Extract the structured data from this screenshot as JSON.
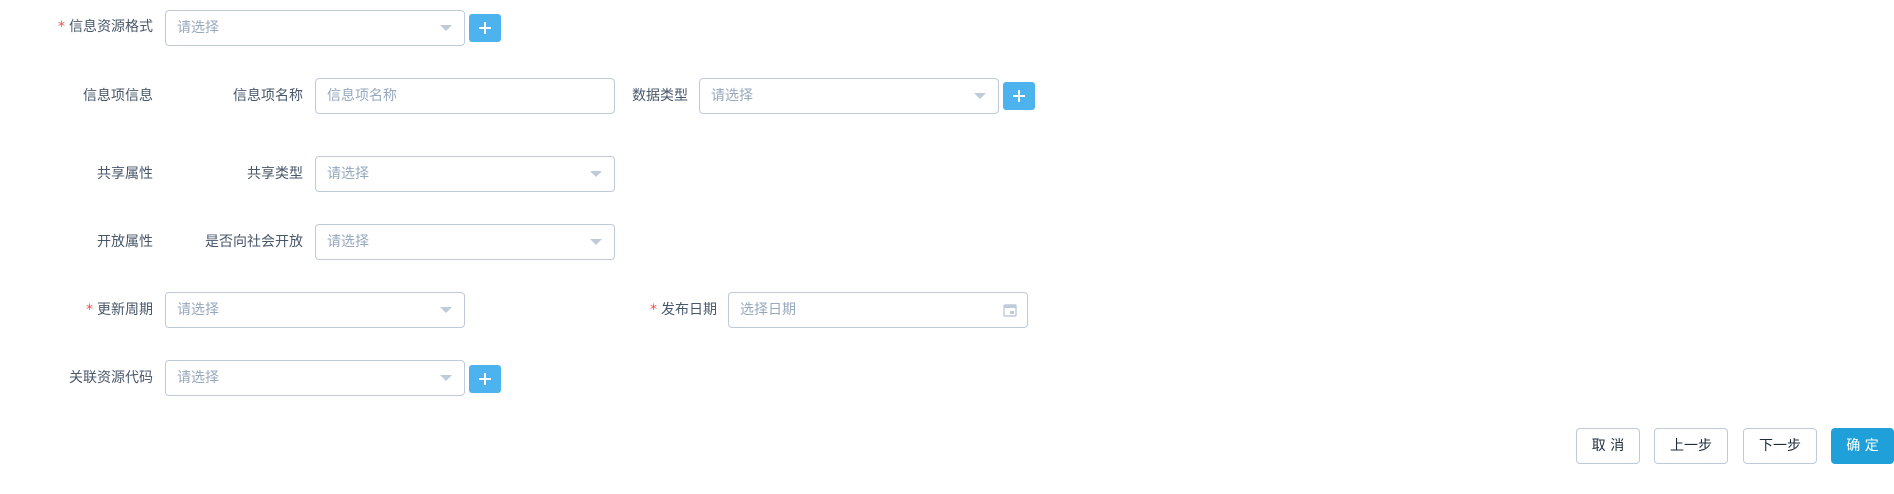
{
  "form": {
    "info_resource_format": {
      "label": "信息资源格式",
      "placeholder": "请选择"
    },
    "info_item": {
      "section_label": "信息项信息",
      "name_label": "信息项名称",
      "name_placeholder": "信息项名称",
      "data_type_label": "数据类型",
      "data_type_placeholder": "请选择"
    },
    "share": {
      "section_label": "共享属性",
      "type_label": "共享类型",
      "type_placeholder": "请选择"
    },
    "open": {
      "section_label": "开放属性",
      "public_label": "是否向社会开放",
      "public_placeholder": "请选择"
    },
    "update_cycle": {
      "label": "更新周期",
      "placeholder": "请选择"
    },
    "publish_date": {
      "label": "发布日期",
      "placeholder": "选择日期"
    },
    "related_resource": {
      "label": "关联资源代码",
      "placeholder": "请选择"
    },
    "required_mark": "*"
  },
  "actions": {
    "cancel": "取 消",
    "prev": "上一步",
    "next": "下一步",
    "confirm": "确 定"
  },
  "colors": {
    "primary": "#20a0d8",
    "add_button": "#4db3ee",
    "required": "#ff4949",
    "border": "#bfcbd9",
    "placeholder": "#97a8be"
  },
  "icons": [
    "chevron-down-icon",
    "plus-icon",
    "calendar-icon"
  ]
}
